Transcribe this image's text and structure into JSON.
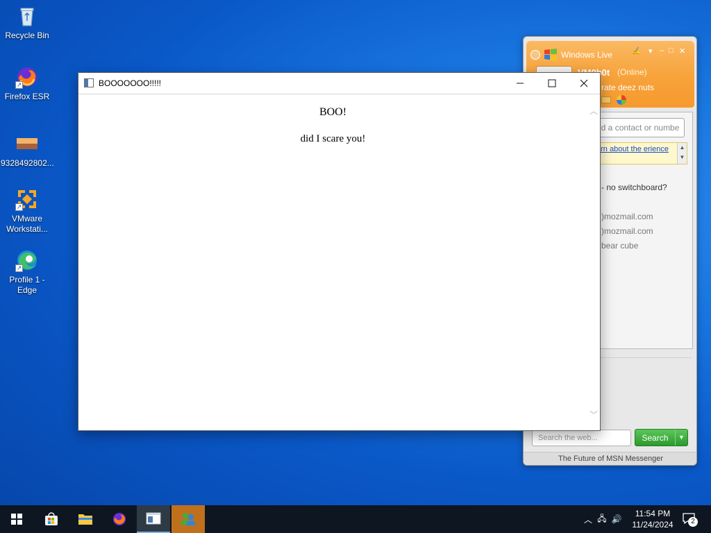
{
  "desktop": {
    "icons": [
      {
        "label": "Recycle Bin"
      },
      {
        "label": "Firefox ESR"
      },
      {
        "label": "9328492802..."
      },
      {
        "label": "VMware Workstati..."
      },
      {
        "label": "Profile 1 - Edge"
      }
    ]
  },
  "main_window": {
    "title": "BOOOOOOO!!!!!",
    "heading": "BOO!",
    "line": "did I scare you!"
  },
  "messenger": {
    "brand": "Windows Live",
    "display_name": "VM0b0t",
    "status": "(Online)",
    "personal_message": "rate deez nuts",
    "find_placeholder": "nd a contact or numbe",
    "banner_text": "arn about the erience",
    "contacts": [
      "- no switchboard?",
      ")mozmail.com",
      ")mozmail.com",
      "bear cube"
    ],
    "web_search_placeholder": "Search the web...",
    "search_button": "Search",
    "footer": "The Future of MSN Messenger"
  },
  "taskbar": {
    "time": "11:54 PM",
    "date": "11/24/2024",
    "notification_count": "2"
  },
  "colors": {
    "msn_orange": "#f7a23a",
    "desktop_blue": "#1976e0",
    "taskbar": "#0e1621",
    "search_green": "#2c9a2c"
  }
}
